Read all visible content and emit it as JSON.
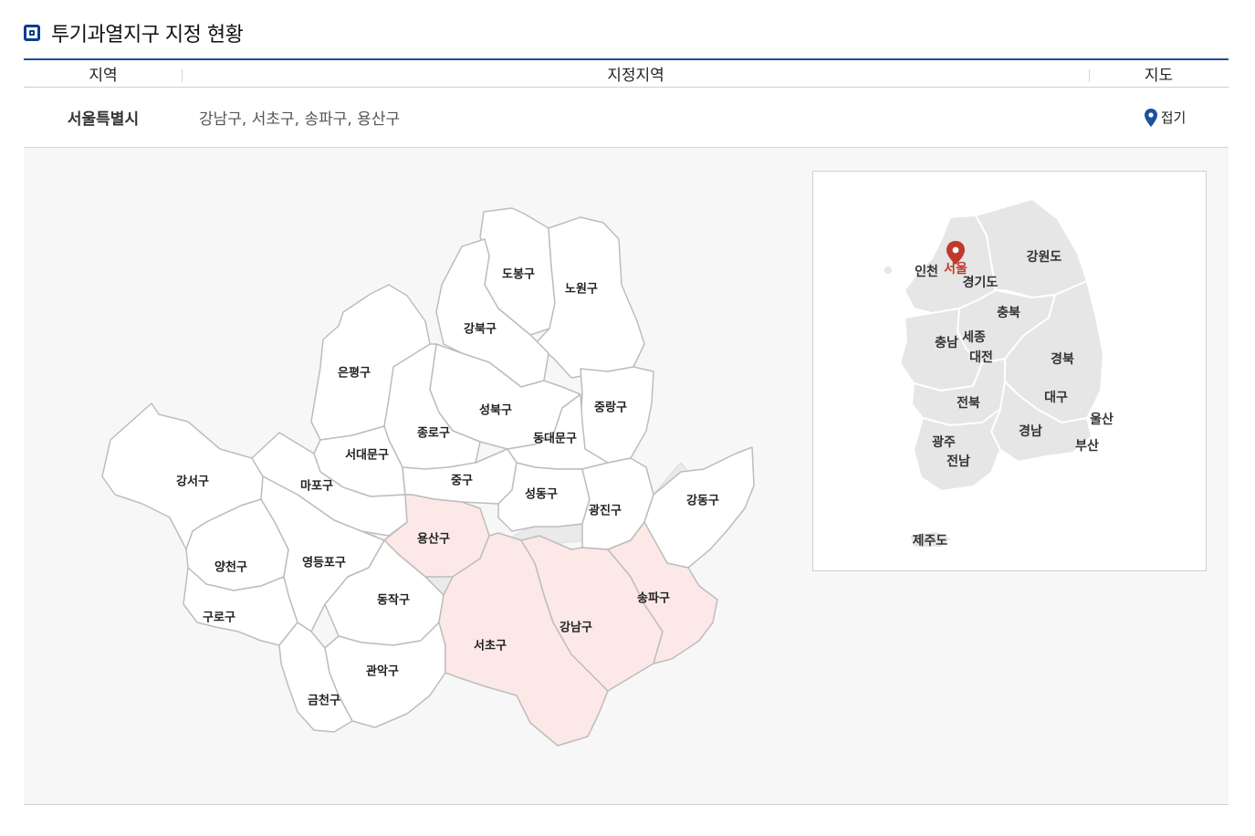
{
  "section": {
    "title": "투기과열지구 지정 현황"
  },
  "table": {
    "headers": {
      "region": "지역",
      "designated": "지정지역",
      "map": "지도"
    },
    "row": {
      "region": "서울특별시",
      "districts": "강남구, 서초구, 송파구, 용산구",
      "toggle_label": "접기"
    }
  },
  "colors": {
    "accent": "#1d4fa3",
    "designated_fill": "#fde8e8",
    "marker": "#c0392b",
    "pin": "#1d4fa3"
  },
  "seoul_map": {
    "districts": {
      "dobong": "도봉구",
      "nowon": "노원구",
      "gangbuk": "강북구",
      "eunpyeong": "은평구",
      "seongbuk": "성북구",
      "jungnang": "중랑구",
      "jongno": "종로구",
      "dongdaemun": "동대문구",
      "seodaemun": "서대문구",
      "gangseo": "강서구",
      "mapo": "마포구",
      "jung": "중구",
      "seongdong": "성동구",
      "gwangjin": "광진구",
      "gangdong": "강동구",
      "yongsan": "용산구",
      "yangcheon": "양천구",
      "yeongdeungpo": "영등포구",
      "dongjak": "동작구",
      "songpa": "송파구",
      "guro": "구로구",
      "gangnam": "강남구",
      "seocho": "서초구",
      "gwanak": "관악구",
      "geumcheon": "금천구"
    },
    "designated": [
      "용산구",
      "서초구",
      "강남구",
      "송파구"
    ]
  },
  "korea_map": {
    "marker_label": "서울",
    "labels": {
      "incheon": "인천",
      "gangwon": "강원도",
      "gyeonggi": "경기도",
      "chungbuk": "충북",
      "chungnam": "충남",
      "sejong": "세종",
      "daejeon": "대전",
      "gyeongbuk": "경북",
      "jeonbuk": "전북",
      "daegu": "대구",
      "ulsan": "울산",
      "gwangju": "광주",
      "gyeongnam": "경남",
      "busan": "부산",
      "jeonnam": "전남",
      "jeju": "제주도"
    }
  }
}
